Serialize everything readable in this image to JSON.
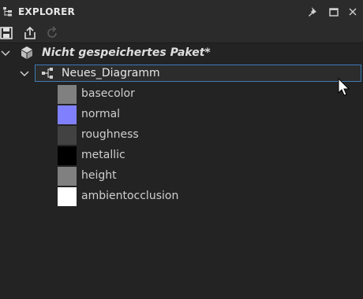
{
  "panel": {
    "title": "EXPLORER",
    "icons": [
      "explorer-tree-icon",
      "pin-icon",
      "maximize-icon",
      "close-icon"
    ]
  },
  "toolbar": {
    "icons": [
      "save-icon",
      "export-icon",
      "refresh-icon"
    ]
  },
  "tree": {
    "package": {
      "label": "Nicht gespeichertes Paket*",
      "icon": "package-cube-icon",
      "expanded": true
    },
    "graph": {
      "label": "Neues_Diagramm",
      "icon": "graph-nodes-icon",
      "expanded": true,
      "selected": true
    },
    "outputs": [
      {
        "label": "basecolor",
        "color": "#808080"
      },
      {
        "label": "normal",
        "color": "#8080ff"
      },
      {
        "label": "roughness",
        "color": "#424242"
      },
      {
        "label": "metallic",
        "color": "#000000"
      },
      {
        "label": "height",
        "color": "#808080"
      },
      {
        "label": "ambientocclusion",
        "color": "#ffffff"
      }
    ]
  },
  "colors": {
    "background": "#232323",
    "header": "#2b2b2b",
    "selection_border": "#3f7ab8"
  }
}
